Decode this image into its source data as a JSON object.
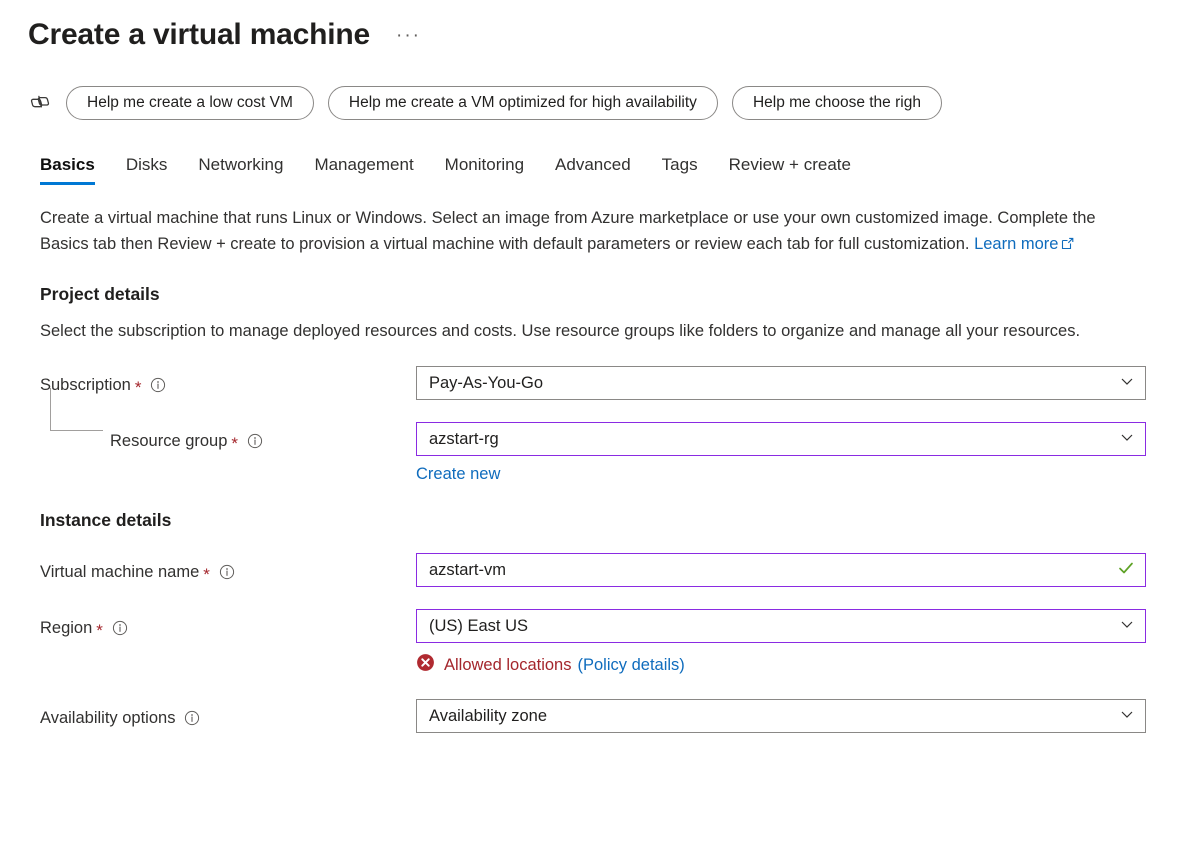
{
  "header": {
    "title": "Create a virtual machine",
    "ellipsis_label": "···",
    "more_commands_name": "More commands"
  },
  "copilot": {
    "icon": "copilot-icon",
    "prompts": [
      {
        "label": "Help me create a low cost VM"
      },
      {
        "label": "Help me create a VM optimized for high availability"
      },
      {
        "label": "Help me choose the righ"
      }
    ]
  },
  "tabs": {
    "active": "Basics",
    "items": [
      {
        "label": "Basics",
        "active": true
      },
      {
        "label": "Disks",
        "active": false
      },
      {
        "label": "Networking",
        "active": false
      },
      {
        "label": "Management",
        "active": false
      },
      {
        "label": "Monitoring",
        "active": false
      },
      {
        "label": "Advanced",
        "active": false
      },
      {
        "label": "Tags",
        "active": false
      },
      {
        "label": "Review + create",
        "active": false
      }
    ]
  },
  "intro": {
    "text": "Create a virtual machine that runs Linux or Windows. Select an image from Azure marketplace or use your own customized image. Complete the Basics tab then Review + create to provision a virtual machine with default parameters or review each tab for full customization. ",
    "learn_more": "Learn more"
  },
  "project_details": {
    "heading": "Project details",
    "description": "Select the subscription to manage deployed resources and costs. Use resource groups like folders to organize and manage all your resources.",
    "subscription": {
      "label": "Subscription",
      "required": "*",
      "value": "Pay-As-You-Go"
    },
    "resource_group": {
      "label": "Resource group",
      "required": "*",
      "value": "azstart-rg",
      "create_new": "Create new"
    }
  },
  "instance_details": {
    "heading": "Instance details",
    "vm_name": {
      "label": "Virtual machine name",
      "required": "*",
      "value": "azstart-vm"
    },
    "region": {
      "label": "Region",
      "required": "*",
      "value": "(US) East US",
      "error_text": "Allowed locations",
      "policy_link": "(Policy details)"
    },
    "availability_options": {
      "label": "Availability options",
      "value": "Availability zone"
    }
  },
  "colors": {
    "accent": "#0078d4",
    "link": "#0f6cbd",
    "required_asterisk": "#a4262c",
    "error": "#a4262c",
    "modified_border": "#8a2be2",
    "success_check": "#5ea226",
    "border": "#8a8886"
  }
}
